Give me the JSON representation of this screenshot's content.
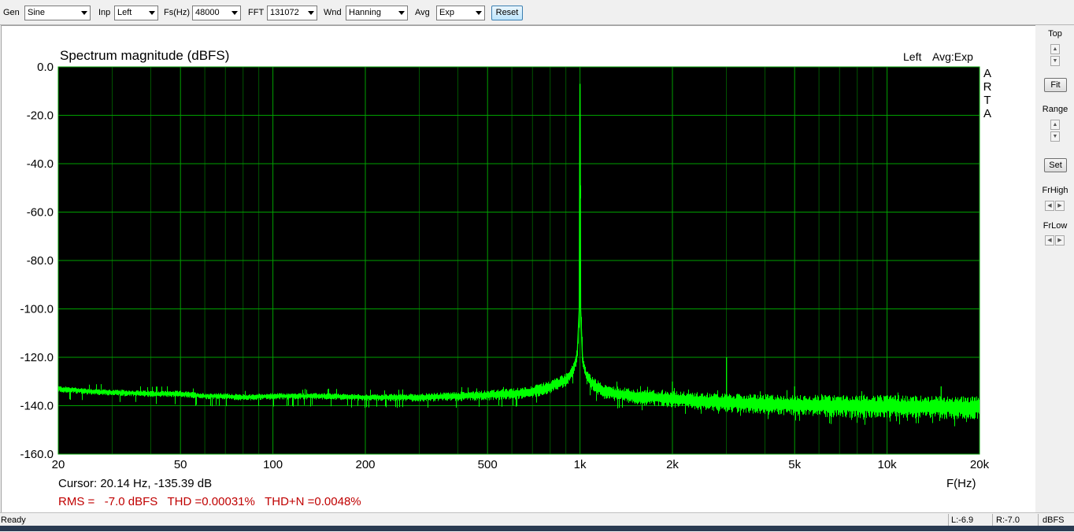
{
  "toolbar": {
    "gen": {
      "label": "Gen",
      "value": "Sine"
    },
    "inp": {
      "label": "Inp",
      "value": "Left"
    },
    "fs": {
      "label": "Fs(Hz)",
      "value": "48000"
    },
    "fft": {
      "label": "FFT",
      "value": "131072"
    },
    "wnd": {
      "label": "Wnd",
      "value": "Hanning"
    },
    "avg": {
      "label": "Avg",
      "value": "Exp"
    },
    "reset_label": "Reset"
  },
  "plot": {
    "title": "Spectrum magnitude (dBFS)",
    "channel": "Left",
    "avg_mode": "Avg:Exp",
    "brand_letters": [
      "A",
      "R",
      "T",
      "A"
    ],
    "cursor_text": "Cursor: 20.14 Hz, -135.39 dB",
    "measure_text": "RMS =   -7.0 dBFS   THD =0.00031%   THD+N =0.0048%",
    "colors": {
      "background": "#000000",
      "grid": "#00a000",
      "trace": "#00ff00",
      "measure": "#c00000"
    }
  },
  "chart_data": {
    "type": "line",
    "title": "Spectrum magnitude (dBFS)",
    "xlabel": "F(Hz)",
    "ylabel": "",
    "x_scale": "log",
    "xlim": [
      20,
      20000
    ],
    "ylim": [
      -160,
      0
    ],
    "grid": true,
    "x_ticks": [
      {
        "value": 20,
        "label": "20"
      },
      {
        "value": 50,
        "label": "50"
      },
      {
        "value": 100,
        "label": "100"
      },
      {
        "value": 200,
        "label": "200"
      },
      {
        "value": 500,
        "label": "500"
      },
      {
        "value": 1000,
        "label": "1k"
      },
      {
        "value": 2000,
        "label": "2k"
      },
      {
        "value": 5000,
        "label": "5k"
      },
      {
        "value": 10000,
        "label": "10k"
      },
      {
        "value": 20000,
        "label": "20k"
      }
    ],
    "y_ticks": [
      {
        "value": 0,
        "label": "0.0"
      },
      {
        "value": -20,
        "label": "-20.0"
      },
      {
        "value": -40,
        "label": "-40.0"
      },
      {
        "value": -60,
        "label": "-60.0"
      },
      {
        "value": -80,
        "label": "-80.0"
      },
      {
        "value": -100,
        "label": "-100.0"
      },
      {
        "value": -120,
        "label": "-120.0"
      },
      {
        "value": -140,
        "label": "-140.0"
      },
      {
        "value": -160,
        "label": "-160.0"
      }
    ],
    "series": [
      {
        "points": [
          [
            20,
            -133
          ],
          [
            25,
            -134
          ],
          [
            30,
            -134.5
          ],
          [
            40,
            -135
          ],
          [
            50,
            -135
          ],
          [
            60,
            -136
          ],
          [
            70,
            -136
          ],
          [
            80,
            -136.5
          ],
          [
            100,
            -136
          ],
          [
            150,
            -136
          ],
          [
            200,
            -136.5
          ],
          [
            300,
            -136.5
          ],
          [
            400,
            -136
          ],
          [
            500,
            -135.5
          ],
          [
            600,
            -135
          ],
          [
            700,
            -134
          ],
          [
            800,
            -132
          ],
          [
            900,
            -129
          ],
          [
            950,
            -125
          ],
          [
            980,
            -118
          ],
          [
            995,
            -100
          ],
          [
            1000,
            -7
          ],
          [
            1005,
            -100
          ],
          [
            1020,
            -122
          ],
          [
            1050,
            -128
          ],
          [
            1100,
            -131
          ],
          [
            1200,
            -134
          ],
          [
            1500,
            -136
          ],
          [
            2000,
            -137
          ],
          [
            3000,
            -138.5
          ],
          [
            5000,
            -139.5
          ],
          [
            10000,
            -140
          ],
          [
            20000,
            -140.5
          ]
        ],
        "spurs": [
          {
            "x": 2000,
            "y": -130
          },
          {
            "x": 3000,
            "y": -120
          },
          {
            "x": 5000,
            "y": -132
          },
          {
            "x": 15000,
            "y": -132
          }
        ]
      }
    ]
  },
  "side": {
    "top_label": "Top",
    "fit_label": "Fit",
    "range_label": "Range",
    "set_label": "Set",
    "frhigh_label": "FrHigh",
    "frlow_label": "FrLow"
  },
  "status": {
    "text": "Ready",
    "left_level": "L:-6.9",
    "right_level": "R:-7.0",
    "unit": "dBFS"
  }
}
